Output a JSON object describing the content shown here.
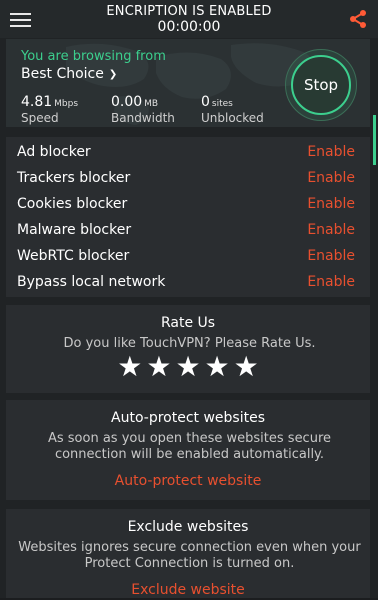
{
  "header": {
    "title": "ENCRIPTION IS ENABLED",
    "timer": "00:00:00",
    "menu_icon": "menu-icon",
    "share_icon": "share-icon",
    "accent": "#ff5a36"
  },
  "hero": {
    "browsing_label": "You are browsing from",
    "location": "Best Choice",
    "stats": [
      {
        "value": "4.81",
        "unit": "Mbps",
        "label": "Speed"
      },
      {
        "value": "0.00",
        "unit": "MB",
        "label": "Bandwidth"
      },
      {
        "value": "0",
        "unit": "sites",
        "label": "Unblocked"
      }
    ],
    "stop_label": "Stop",
    "accent": "#3ccf8e"
  },
  "blockers": [
    {
      "name": "Ad blocker",
      "action": "Enable"
    },
    {
      "name": "Trackers blocker",
      "action": "Enable"
    },
    {
      "name": "Cookies blocker",
      "action": "Enable"
    },
    {
      "name": "Malware blocker",
      "action": "Enable"
    },
    {
      "name": "WebRTC blocker",
      "action": "Enable"
    },
    {
      "name": "Bypass local network",
      "action": "Enable"
    }
  ],
  "rate": {
    "title": "Rate Us",
    "text": "Do you like TouchVPN? Please Rate Us.",
    "stars": 5
  },
  "autoprotect": {
    "title": "Auto-protect websites",
    "text": "As soon as you open these websites secure connection will be enabled automatically.",
    "link": "Auto-protect website"
  },
  "exclude": {
    "title": "Exclude websites",
    "text": "Websites ignores secure connection even when your Protect Connection is turned on.",
    "link": "Exclude website"
  }
}
